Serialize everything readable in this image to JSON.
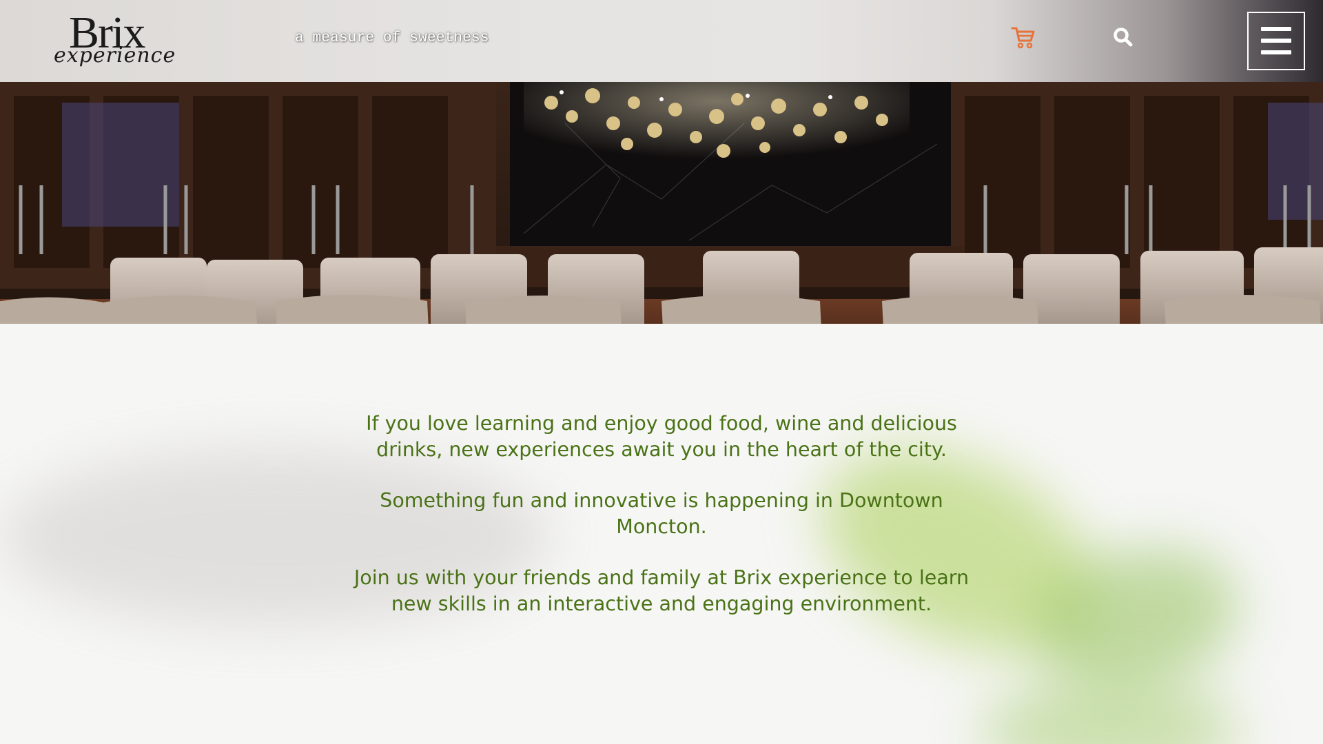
{
  "brand": {
    "logo_main": "Brix",
    "logo_sub": "experience",
    "tagline": "a measure of sweetness"
  },
  "header": {
    "cart_icon": "cart-icon",
    "search_icon": "search-icon",
    "menu_icon": "hamburger-menu-icon"
  },
  "colors": {
    "cart_accent": "#e8733a",
    "text_green": "#4a7216",
    "menu_border": "#ffffff"
  },
  "intro": {
    "paragraph_1": "If you love learning and enjoy good food, wine and delicious drinks, new experiences await you in the heart of the city.",
    "paragraph_2": "Something fun and innovative is happening in Downtown Moncton.",
    "paragraph_3": "Join us with your friends and family at Brix experience to learn new skills in an interactive and engaging environment."
  }
}
